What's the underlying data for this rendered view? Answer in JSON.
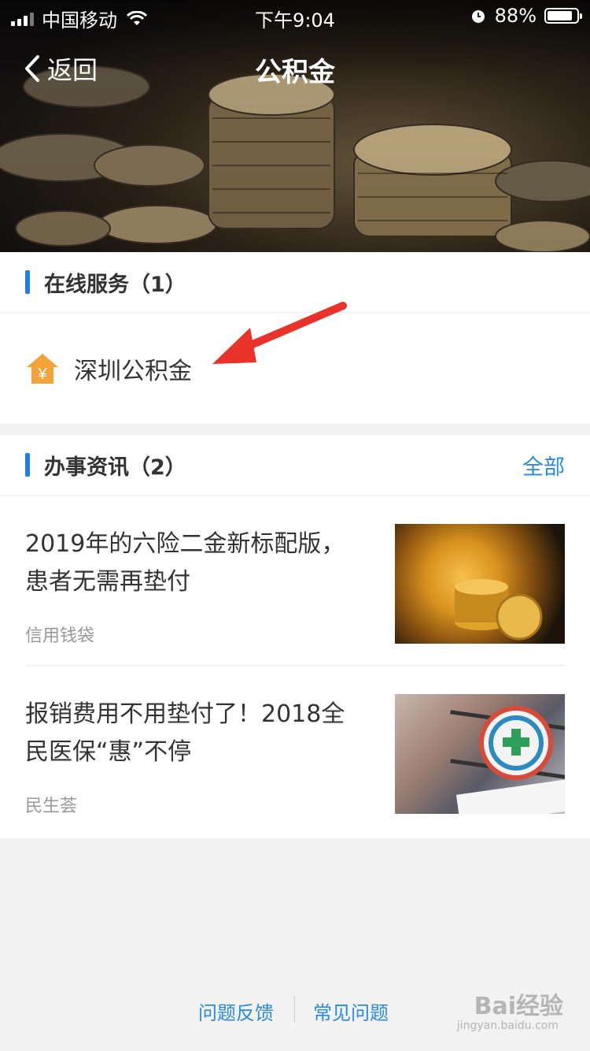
{
  "status_bar": {
    "carrier": "中国移动",
    "time": "下午9:04",
    "battery_percent": "88%",
    "battery_level": 0.88
  },
  "nav": {
    "back_label": "返回",
    "title": "公积金"
  },
  "online_service": {
    "title": "在线服务（1）",
    "items": [
      {
        "label": "深圳公积金",
        "icon": "house-yen-icon",
        "icon_glyph": "¥"
      }
    ]
  },
  "news": {
    "title": "办事资讯（2）",
    "more_label": "全部",
    "items": [
      {
        "title": "2019年的六险二金新标配版，患者无需再垫付",
        "source": "信用钱袋",
        "thumbnail": "gold-coins-image"
      },
      {
        "title": "报销费用不用垫付了！2018全民医保“惠”不停",
        "source": "民生荟",
        "thumbnail": "medical-insurance-badge-image"
      }
    ]
  },
  "footer": {
    "feedback": "问题反馈",
    "faq": "常见问题"
  },
  "watermark": {
    "brand": "Bai经验",
    "url": "jingyan.baidu.com"
  },
  "colors": {
    "accent": "#1e7fe0",
    "link": "#2a8ae0",
    "icon_orange": "#f2a33a",
    "annotation_arrow": "#e8322a"
  }
}
